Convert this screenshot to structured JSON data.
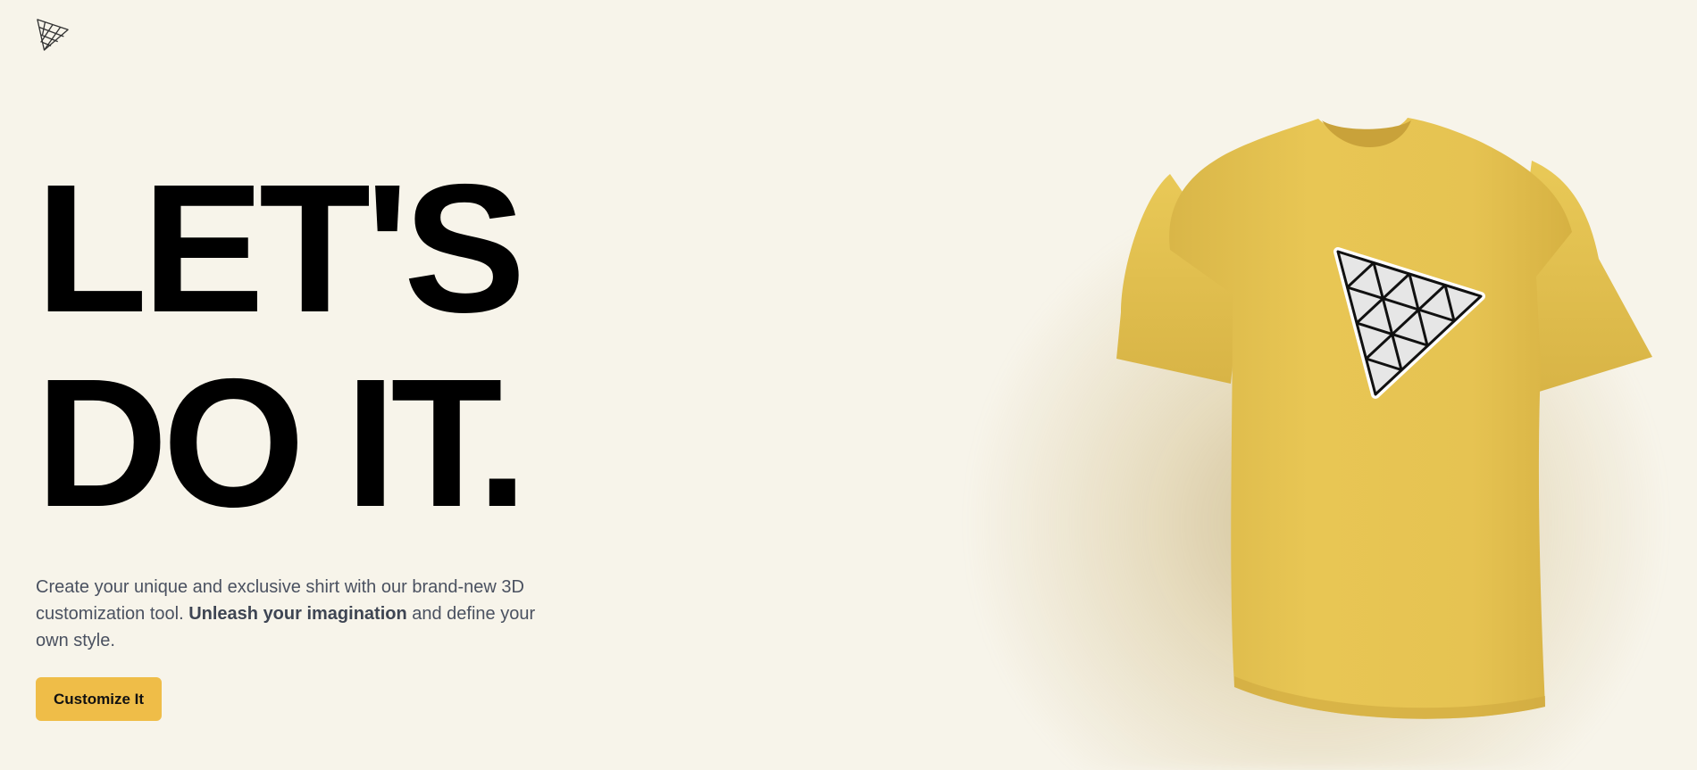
{
  "brand": {
    "logo_icon": "triangle-mesh-logo-icon"
  },
  "hero": {
    "headline_line1": "LET'S",
    "headline_line2": "DO IT.",
    "description_part1": "Create your unique and exclusive shirt with our brand-new 3D customization tool. ",
    "description_emphasis": "Unleash your imagination",
    "description_part2": " and define your own style.",
    "cta_label": "Customize It"
  },
  "product": {
    "item": "t-shirt",
    "shirt_color": "#e8c654",
    "decal_icon": "triangle-mesh-decal-icon"
  },
  "colors": {
    "background": "#f7f4ea",
    "accent": "#efbd48",
    "text_dark": "#000000",
    "text_body": "#4a5160"
  }
}
